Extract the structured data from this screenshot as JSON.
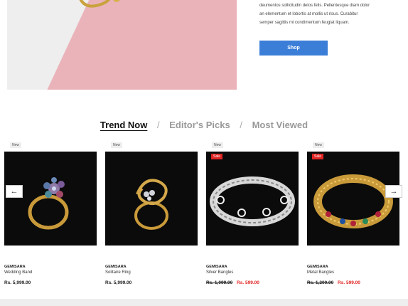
{
  "hero": {
    "text_lines": [
      "deumentos sollicitudin delos felis. Pellentesque diam dolor",
      "an elementum et lobortis at mollis ut risus. Curabitur",
      "semper sagittis mi condimentum feugiat liquam."
    ],
    "shop_label": "Shop",
    "button_color": "#3b7ed8"
  },
  "tabs": [
    {
      "label": "Trend Now",
      "active": true
    },
    {
      "label": "Editor's Picks",
      "active": false
    },
    {
      "label": "Most Viewed",
      "active": false
    }
  ],
  "tab_separator": "/",
  "carousel": {
    "prev_icon": "arrow-left-icon",
    "next_icon": "arrow-right-icon",
    "prev_glyph": "←",
    "next_glyph": "→"
  },
  "products": [
    {
      "badge": "New",
      "sale": "",
      "brand": "GEMISARA",
      "name": "Wedding Band",
      "old_price": "",
      "price": "Rs. 5,999.00"
    },
    {
      "badge": "New",
      "sale": "",
      "brand": "GEMISARA",
      "name": "Solitaire Ring",
      "old_price": "",
      "price": "Rs. 5,999.00"
    },
    {
      "badge": "New",
      "sale": "Sale",
      "brand": "GEMISARA",
      "name": "Silver Bangles",
      "old_price": "Rs. 1,099.00",
      "price": "Rs. 599.00"
    },
    {
      "badge": "New",
      "sale": "Sale",
      "brand": "GEMISARA",
      "name": "Metal Bangles",
      "old_price": "Rs. 1,200.00",
      "price": "Rs. 599.00"
    }
  ],
  "colors": {
    "sale": "#e02424",
    "accent": "#3b7ed8"
  }
}
